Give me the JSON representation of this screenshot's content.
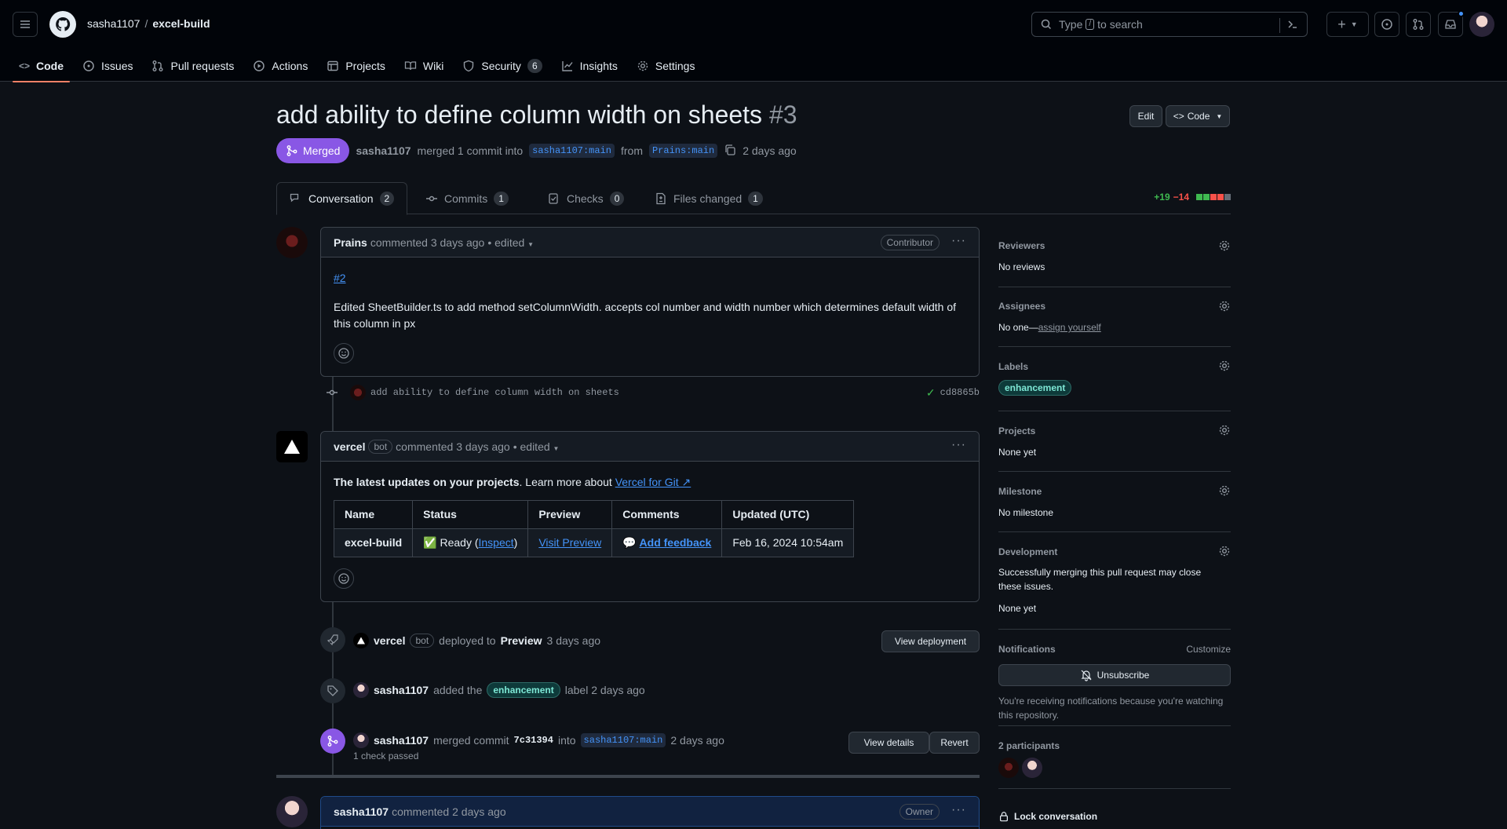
{
  "header": {
    "owner": "sasha1107",
    "repo": "excel-build",
    "search_placeholder_prefix": "Type",
    "search_key": "/",
    "search_placeholder_suffix": "to search"
  },
  "repo_nav": {
    "code": "Code",
    "issues": "Issues",
    "pulls": "Pull requests",
    "actions": "Actions",
    "projects": "Projects",
    "wiki": "Wiki",
    "security": "Security",
    "security_count": "6",
    "insights": "Insights",
    "settings": "Settings"
  },
  "pr": {
    "title": "add ability to define column width on sheets",
    "number": "#3",
    "edit_label": "Edit",
    "code_label": "Code",
    "state": "Merged",
    "author": "sasha1107",
    "merged_text": "merged 1 commit into",
    "base_branch": "sasha1107:main",
    "from_text": "from",
    "head_branch": "Prains:main",
    "time": "2 days ago"
  },
  "tabs": [
    {
      "label": "Conversation",
      "count": "2"
    },
    {
      "label": "Commits",
      "count": "1"
    },
    {
      "label": "Checks",
      "count": "0"
    },
    {
      "label": "Files changed",
      "count": "1"
    }
  ],
  "diffstat": {
    "additions": "+19",
    "deletions": "−14"
  },
  "comment1": {
    "author": "Prains",
    "meta": "commented 3 days ago",
    "edited": "• edited",
    "role": "Contributor",
    "link": "#2",
    "body": "Edited SheetBuilder.ts to add method setColumnWidth. accepts col number and width number which determines default width of this column in px"
  },
  "commit_event": {
    "message": "add ability to define column width on sheets",
    "sha": "cd8865b"
  },
  "comment2": {
    "author": "vercel",
    "bot": "bot",
    "meta": "commented 3 days ago",
    "edited": "• edited",
    "intro_bold": "The latest updates on your projects",
    "intro_rest": ". Learn more about",
    "intro_link": "Vercel for Git ↗",
    "table_headers": [
      "Name",
      "Status",
      "Preview",
      "Comments",
      "Updated (UTC)"
    ],
    "row": {
      "name": "excel-build",
      "status_icon": "✅",
      "status": "Ready (",
      "inspect": "Inspect",
      "status_close": ")",
      "preview": "Visit Preview",
      "comment_icon": "💬",
      "feedback": "Add feedback",
      "updated": "Feb 16, 2024 10:54am"
    }
  },
  "deploy_event": {
    "actor": "vercel",
    "bot": "bot",
    "text": "deployed to",
    "env": "Preview",
    "time": "3 days ago",
    "button": "View deployment"
  },
  "label_event": {
    "actor": "sasha1107",
    "text": "added the",
    "label": "enhancement",
    "text2": "label 2 days ago"
  },
  "merge_event": {
    "actor": "sasha1107",
    "text": "merged commit",
    "sha": "7c31394",
    "into": "into",
    "branch": "sasha1107:main",
    "time": "2 days ago",
    "checks": "1 check passed",
    "details_btn": "View details",
    "revert_btn": "Revert"
  },
  "comment3": {
    "author": "sasha1107",
    "meta": "commented 2 days ago",
    "role": "Owner"
  },
  "sidebar": {
    "reviewers_h": "Reviewers",
    "reviewers_v": "No reviews",
    "assignees_h": "Assignees",
    "assignees_v": "No one—",
    "assign_link": "assign yourself",
    "labels_h": "Labels",
    "labels_v": "enhancement",
    "projects_h": "Projects",
    "projects_v": "None yet",
    "milestone_h": "Milestone",
    "milestone_v": "No milestone",
    "development_h": "Development",
    "development_desc": "Successfully merging this pull request may close these issues.",
    "development_v": "None yet",
    "notifications_h": "Notifications",
    "customize": "Customize",
    "unsubscribe": "Unsubscribe",
    "notif_reason": "You're receiving notifications because you're watching this repository.",
    "participants_h": "2 participants",
    "lock": "Lock conversation"
  },
  "colors": {
    "accent": "#4493f8",
    "merged": "#8957e5",
    "underline": "#f78166"
  }
}
